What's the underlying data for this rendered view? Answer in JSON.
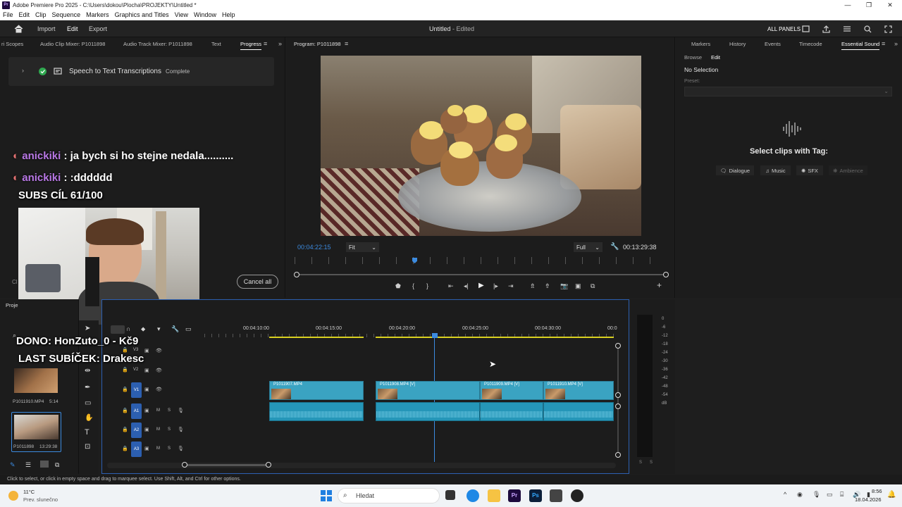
{
  "window": {
    "title": "Adobe Premiere Pro 2025 - C:\\Users\\dokou\\Plocha\\PROJEKTY\\Untitled *",
    "logo_text": "Pr"
  },
  "menu": [
    "File",
    "Edit",
    "Clip",
    "Sequence",
    "Markers",
    "Graphics and Titles",
    "View",
    "Window",
    "Help"
  ],
  "header": {
    "import": "Import",
    "edit": "Edit",
    "export": "Export",
    "doc_title": "Untitled",
    "doc_status": "- Edited",
    "all_panels": "ALL PANELS"
  },
  "left_tabs": [
    "ri Scopes",
    "Audio Clip Mixer: P1011898",
    "Audio Track Mixer: P1011898",
    "Text",
    "Progress"
  ],
  "progress": {
    "label": "Speech to Text Transcriptions",
    "status": "Complete",
    "cancel_all": "Cancel all"
  },
  "chat": [
    {
      "user": "anickiki",
      "text": " : ja bych si ho stejne nedala.........."
    },
    {
      "user": "anickiki",
      "text": " : :dddddd"
    }
  ],
  "overlay": {
    "subs_goal": "SUBS CÍL 61/100",
    "donor": "DONO: HonZuto_0 - Kč9",
    "last_sub": "LAST SUBÍČEK: Drakesc"
  },
  "program": {
    "tab": "Program: P1011898",
    "timecode": "00:04:22:15",
    "fit": "Fit",
    "quality": "Full",
    "duration": "00:13:29:38"
  },
  "right_tabs": [
    "Markers",
    "History",
    "Events",
    "Timecode",
    "Essential Sound"
  ],
  "essential_sound": {
    "browse": "Browse",
    "edit": "Edit",
    "no_selection": "No Selection",
    "preset_label": "Preset:",
    "select_text": "Select clips with Tag:",
    "tags": [
      "Dialogue",
      "Music",
      "SFX",
      "Ambience"
    ]
  },
  "project": {
    "tab": "Proje",
    "items": [
      {
        "name": "P1011910.MP4",
        "duration": "5:14"
      },
      {
        "name": "P1011898",
        "duration": "13:29:38"
      }
    ]
  },
  "timeline": {
    "ruler": [
      "00:04:10:00",
      "00:04:15:00",
      "00:04:20:00",
      "00:04:25:00",
      "00:04:30:00",
      "00:0"
    ],
    "video_tracks": [
      "V3",
      "V2",
      "V1"
    ],
    "audio_tracks": [
      "A1",
      "A2",
      "A3"
    ],
    "mute": "M",
    "solo": "S",
    "clips": [
      {
        "name": "P1011907.MP4"
      },
      {
        "name": "P1011908.MP4 [V]"
      },
      {
        "name": "P1011909.MP4 [V]"
      },
      {
        "name": "P1011910.MP4 [V]"
      }
    ]
  },
  "meter": {
    "scale": [
      "0",
      "-6",
      "-12",
      "-18",
      "-24",
      "-30",
      "-36",
      "-42",
      "-48",
      "-54",
      "dB"
    ],
    "s_labels": [
      "S",
      "S"
    ]
  },
  "status_bar": "Click to select, or click in empty space and drag to marquee select. Use Shift, Alt, and Ctrl for other options.",
  "taskbar": {
    "weather_temp": "11°C",
    "weather_desc": "Prev. slunečno",
    "search": "Hledat",
    "time": "8:56",
    "date": "18.04.2026"
  },
  "colors": {
    "accent_blue": "#2c84d8",
    "clip": "#3aa3c2",
    "chat_user": "#b978e6",
    "bg": "#1e1e1e"
  }
}
